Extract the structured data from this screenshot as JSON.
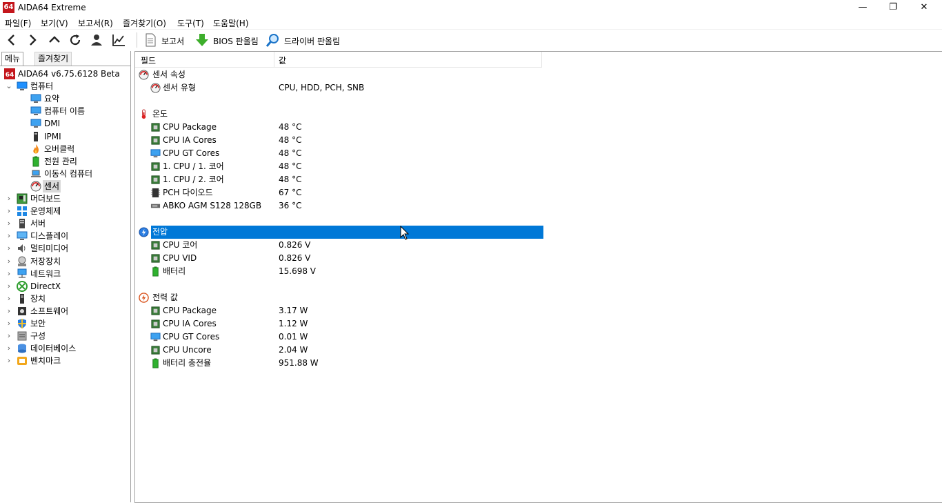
{
  "window": {
    "title": "AIDA64 Extreme",
    "logo": "64",
    "minimize": "—",
    "maximize": "❐",
    "close": "✕"
  },
  "menu": [
    "파일(F)",
    "보기(V)",
    "보고서(R)",
    "즐겨찾기(O)",
    "도구(T)",
    "도움말(H)"
  ],
  "toolbar": {
    "report": "보고서",
    "bios": "BIOS 판올림",
    "driver": "드라이버 판올림"
  },
  "tabs": {
    "menu": "메뉴",
    "favorites": "즐겨찾기"
  },
  "tree": [
    {
      "label": "AIDA64 v6.75.6128 Beta",
      "icon": "aida64-logo-icon",
      "depth": 0,
      "exp": ""
    },
    {
      "label": "컴퓨터",
      "icon": "computer-icon",
      "depth": 1,
      "exp": "v"
    },
    {
      "label": "요약",
      "icon": "monitor-icon",
      "depth": 2,
      "exp": ""
    },
    {
      "label": "컴퓨터 이름",
      "icon": "monitor-icon",
      "depth": 2,
      "exp": ""
    },
    {
      "label": "DMI",
      "icon": "monitor-icon",
      "depth": 2,
      "exp": ""
    },
    {
      "label": "IPMI",
      "icon": "tower-icon",
      "depth": 2,
      "exp": ""
    },
    {
      "label": "오버클럭",
      "icon": "flame-icon",
      "depth": 2,
      "exp": ""
    },
    {
      "label": "전원 관리",
      "icon": "battery-icon",
      "depth": 2,
      "exp": ""
    },
    {
      "label": "이동식 컴퓨터",
      "icon": "laptop-icon",
      "depth": 2,
      "exp": ""
    },
    {
      "label": "센서",
      "icon": "gauge-icon",
      "depth": 2,
      "exp": "",
      "selected": true
    },
    {
      "label": "머더보드",
      "icon": "motherboard-icon",
      "depth": 1,
      "exp": ">"
    },
    {
      "label": "운영체제",
      "icon": "windows-icon",
      "depth": 1,
      "exp": ">"
    },
    {
      "label": "서버",
      "icon": "server-icon",
      "depth": 1,
      "exp": ">"
    },
    {
      "label": "디스플레이",
      "icon": "display-icon",
      "depth": 1,
      "exp": ">"
    },
    {
      "label": "멀티미디어",
      "icon": "speaker-icon",
      "depth": 1,
      "exp": ">"
    },
    {
      "label": "저장장치",
      "icon": "storage-icon",
      "depth": 1,
      "exp": ">"
    },
    {
      "label": "네트워크",
      "icon": "network-icon",
      "depth": 1,
      "exp": ">"
    },
    {
      "label": "DirectX",
      "icon": "xbox-icon",
      "depth": 1,
      "exp": ">"
    },
    {
      "label": "장치",
      "icon": "device-icon",
      "depth": 1,
      "exp": ">"
    },
    {
      "label": "소프트웨어",
      "icon": "software-icon",
      "depth": 1,
      "exp": ">"
    },
    {
      "label": "보안",
      "icon": "shield-icon",
      "depth": 1,
      "exp": ">"
    },
    {
      "label": "구성",
      "icon": "config-icon",
      "depth": 1,
      "exp": ">"
    },
    {
      "label": "데이터베이스",
      "icon": "database-icon",
      "depth": 1,
      "exp": ">"
    },
    {
      "label": "벤치마크",
      "icon": "benchmark-icon",
      "depth": 1,
      "exp": ">"
    }
  ],
  "columns": {
    "field": "필드",
    "value": "값"
  },
  "groups": [
    {
      "label": "센서 속성",
      "icon": "gauge-icon",
      "selected": false,
      "rows": [
        {
          "label": "센서 유형",
          "value": "CPU, HDD, PCH, SNB",
          "icon": "gauge-icon"
        }
      ]
    },
    {
      "label": "온도",
      "icon": "thermometer-icon",
      "selected": false,
      "rows": [
        {
          "label": "CPU Package",
          "value": "48 °C",
          "icon": "chip-icon"
        },
        {
          "label": "CPU IA Cores",
          "value": "48 °C",
          "icon": "chip-icon"
        },
        {
          "label": "CPU GT Cores",
          "value": "48 °C",
          "icon": "gpu-icon"
        },
        {
          "label": "1. CPU / 1. 코어",
          "value": "48 °C",
          "icon": "chip-icon"
        },
        {
          "label": "1. CPU / 2. 코어",
          "value": "48 °C",
          "icon": "chip-icon"
        },
        {
          "label": "PCH 다이오드",
          "value": "67 °C",
          "icon": "pch-icon"
        },
        {
          "label": "ABKO AGM S128 128GB",
          "value": "36 °C",
          "icon": "disk-icon"
        }
      ]
    },
    {
      "label": "전압",
      "icon": "voltage-icon",
      "selected": true,
      "rows": [
        {
          "label": "CPU 코어",
          "value": "0.826 V",
          "icon": "chip-icon"
        },
        {
          "label": "CPU VID",
          "value": "0.826 V",
          "icon": "chip-icon"
        },
        {
          "label": "배터리",
          "value": "15.698 V",
          "icon": "battery-icon"
        }
      ]
    },
    {
      "label": "전력 값",
      "icon": "power-icon",
      "selected": false,
      "rows": [
        {
          "label": "CPU Package",
          "value": "3.17 W",
          "icon": "chip-icon"
        },
        {
          "label": "CPU IA Cores",
          "value": "1.12 W",
          "icon": "chip-icon"
        },
        {
          "label": "CPU GT Cores",
          "value": "0.01 W",
          "icon": "gpu-icon"
        },
        {
          "label": "CPU Uncore",
          "value": "2.04 W",
          "icon": "chip-icon"
        },
        {
          "label": "배터리 충전율",
          "value": "951.88 W",
          "icon": "battery-icon"
        }
      ]
    }
  ],
  "colors": {
    "selection": "#0078d7",
    "tree_selection": "#d9d9d9",
    "brand": "#c4161c"
  }
}
